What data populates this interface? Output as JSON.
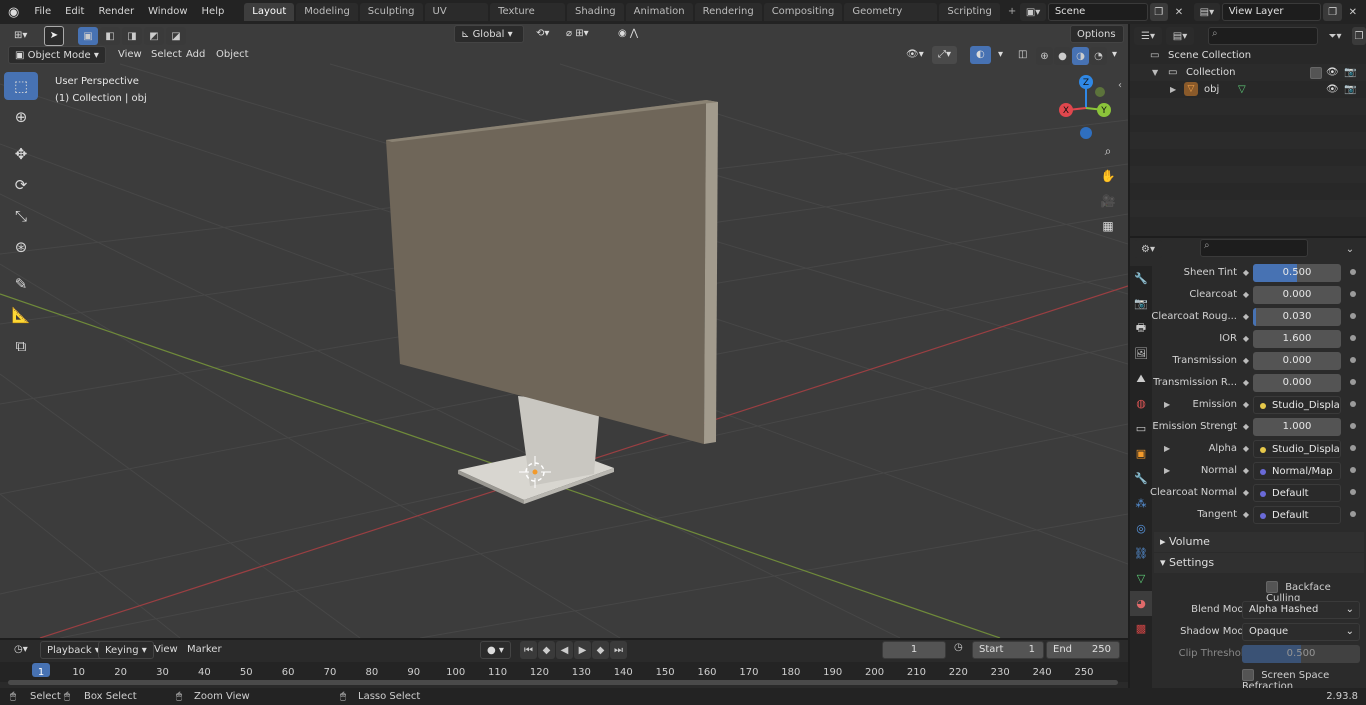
{
  "topbar": {
    "menus": [
      "File",
      "Edit",
      "Render",
      "Window",
      "Help"
    ],
    "workspaces": [
      "Layout",
      "Modeling",
      "Sculpting",
      "UV Editing",
      "Texture Paint",
      "Shading",
      "Animation",
      "Rendering",
      "Compositing",
      "Geometry Nodes",
      "Scripting"
    ],
    "active_workspace": "Layout",
    "scene": "Scene",
    "view_layer": "View Layer"
  },
  "viewport": {
    "mode": "Object Mode",
    "menus": [
      "View",
      "Select",
      "Add",
      "Object"
    ],
    "transform_orientation": "Global",
    "options_label": "Options",
    "perspective_label": "User Perspective",
    "collection_label": "(1) Collection | obj",
    "gizmo": {
      "x": "X",
      "y": "Y",
      "z": "Z"
    }
  },
  "outliner": {
    "search_placeholder": "",
    "scene_collection": "Scene Collection",
    "collection": "Collection",
    "object": "obj"
  },
  "properties": {
    "search_placeholder": "",
    "rows": [
      {
        "label": "Sheen Tint",
        "value": "0.500",
        "fill": 0.5,
        "type": "number"
      },
      {
        "label": "Clearcoat",
        "value": "0.000",
        "fill": 0,
        "type": "number"
      },
      {
        "label": "Clearcoat Roug...",
        "value": "0.030",
        "fill": 0.03,
        "type": "number"
      },
      {
        "label": "IOR",
        "value": "1.600",
        "fill": 0,
        "type": "number"
      },
      {
        "label": "Transmission",
        "value": "0.000",
        "fill": 0,
        "type": "number"
      },
      {
        "label": "Transmission R...",
        "value": "0.000",
        "fill": 0,
        "type": "number"
      },
      {
        "label": "Emission",
        "value": "Studio_Display_with...",
        "type": "link",
        "dot": "#e6c84a",
        "expand": true
      },
      {
        "label": "Emission Strengt",
        "value": "1.000",
        "fill": 0,
        "type": "number"
      },
      {
        "label": "Alpha",
        "value": "Studio_Display_with...",
        "type": "link",
        "dot": "#e6c84a",
        "expand": true
      },
      {
        "label": "Normal",
        "value": "Normal/Map",
        "type": "link",
        "dot": "#6a6ad8",
        "expand": true
      },
      {
        "label": "Clearcoat Normal",
        "value": "Default",
        "type": "link",
        "dot": "#6a6ad8"
      },
      {
        "label": "Tangent",
        "value": "Default",
        "type": "link",
        "dot": "#6a6ad8"
      }
    ],
    "volume_panel": "Volume",
    "settings_panel": "Settings",
    "backface_culling": "Backface Culling",
    "blend_mode_label": "Blend Mode",
    "blend_mode": "Alpha Hashed",
    "shadow_mode_label": "Shadow Mode",
    "shadow_mode": "Opaque",
    "clip_threshold_label": "Clip Threshold",
    "clip_threshold": "0.500",
    "clip_threshold_fill": 0.5,
    "screen_space_refraction": "Screen Space Refraction"
  },
  "timeline": {
    "menus": [
      "Playback",
      "Keying",
      "View",
      "Marker"
    ],
    "current_frame": "1",
    "start_label": "Start",
    "start": "1",
    "end_label": "End",
    "end": "250",
    "ticks": [
      "1",
      "10",
      "20",
      "30",
      "40",
      "50",
      "60",
      "70",
      "80",
      "90",
      "100",
      "110",
      "120",
      "130",
      "140",
      "150",
      "160",
      "170",
      "180",
      "190",
      "200",
      "210",
      "220",
      "230",
      "240",
      "250"
    ]
  },
  "statusbar": {
    "select": "Select",
    "box_select": "Box Select",
    "zoom_view": "Zoom View",
    "lasso_select": "Lasso Select",
    "version": "2.93.8"
  },
  "colors": {
    "accent": "#4772b3",
    "x_axis": "#e0474d",
    "y_axis": "#8bc43a",
    "z_axis": "#2f88e6"
  }
}
